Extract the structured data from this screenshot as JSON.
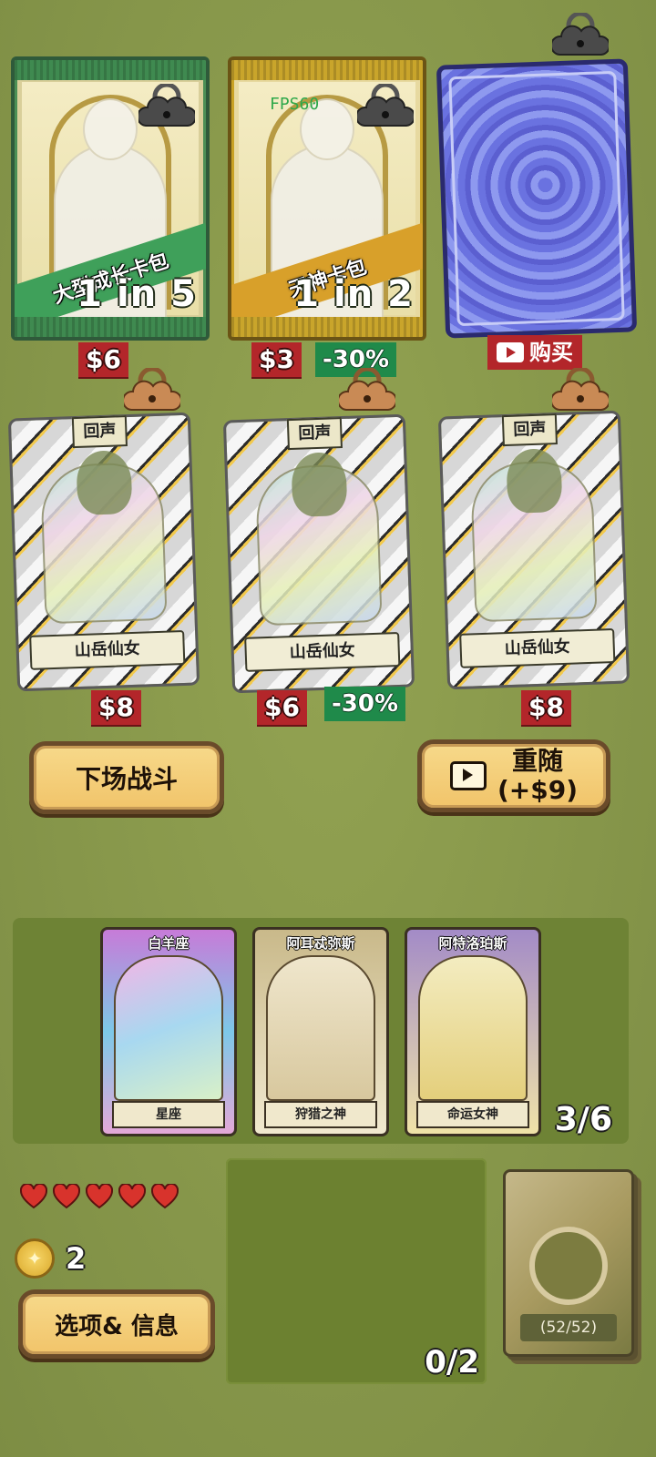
{
  "shop": {
    "packs": [
      {
        "name": "大型成长卡包",
        "odds": "1 in 5",
        "price": "$6",
        "locked": true
      },
      {
        "name": "天神卡包",
        "odds": "1 in 2",
        "price": "$3",
        "discount": "-30%",
        "locked": true
      },
      {
        "buy_label": "购买",
        "locked": true
      }
    ],
    "fps_overlay": "FPS60",
    "cards": [
      {
        "tag": "回声",
        "name": "山岳仙女",
        "price": "$8",
        "locked": true
      },
      {
        "tag": "回声",
        "name": "山岳仙女",
        "price": "$6",
        "discount": "-30%",
        "locked": true
      },
      {
        "tag": "回声",
        "name": "山岳仙女",
        "price": "$8",
        "locked": true
      }
    ]
  },
  "actions": {
    "battle_label": "下场战斗",
    "reroll_label": "重随",
    "reroll_cost": "(+$9)"
  },
  "team": {
    "cards": [
      {
        "title": "白羊座",
        "subtitle": "星座"
      },
      {
        "title": "阿耳忒弥斯",
        "subtitle": "狩猎之神"
      },
      {
        "title": "阿特洛珀斯",
        "subtitle": "命运女神"
      }
    ],
    "count": "3/6"
  },
  "player": {
    "hearts": 5,
    "coins": "2",
    "options_label": "选项& 信息"
  },
  "slots": {
    "count": "0/2"
  },
  "deck": {
    "count": "(52/52)"
  },
  "colors": {
    "background": "#8b9a4c",
    "price_tag": "#b3262a",
    "discount_tag": "#1f8a4a",
    "button": "#f1c46a"
  }
}
